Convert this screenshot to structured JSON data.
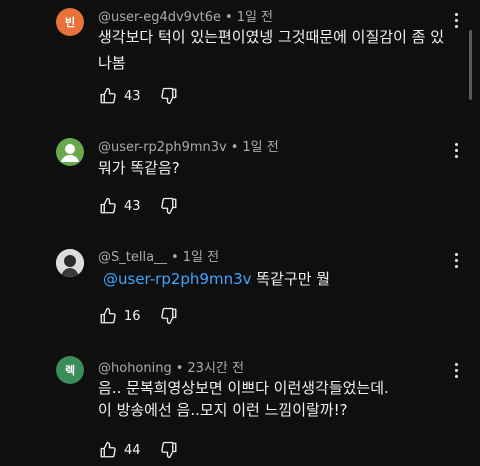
{
  "comments": [
    {
      "avatar": {
        "letter": "빈",
        "color": "#e8733a"
      },
      "username": "@user-eg4dv9vt6e",
      "time": "1일 전",
      "lines": [
        "생각보다 턱이 있는편이였넹 그것때문에 이질감이 좀 있",
        "나봄"
      ],
      "likes": "43"
    },
    {
      "avatar": {
        "letter": "",
        "color": "#6aa84f"
      },
      "username": "@user-rp2ph9mn3v",
      "time": "1일 전",
      "lines": [
        "뭐가 똑같음?"
      ],
      "likes": "43"
    },
    {
      "avatar": {
        "letter": "",
        "color": "#e8e8e8"
      },
      "username": "@S_tella__",
      "time": "1일 전",
      "mention": "@user-rp2ph9mn3v",
      "reply_text": "똑같구만 뭘",
      "likes": "16"
    },
    {
      "avatar": {
        "letter": "렉",
        "color": "#3b8c5a"
      },
      "username": "@hohoning",
      "time": "23시간 전",
      "lines": [
        "음.. 문복희영상보면 이쁘다 이런생각들었는데.",
        "이 방송에선 음..모지 이런 느낌이랄까!?"
      ],
      "likes": "44"
    }
  ],
  "separator": "•",
  "icons": {
    "like": "thumbs-up-icon",
    "dislike": "thumbs-down-icon",
    "menu": "more-vert-icon"
  }
}
